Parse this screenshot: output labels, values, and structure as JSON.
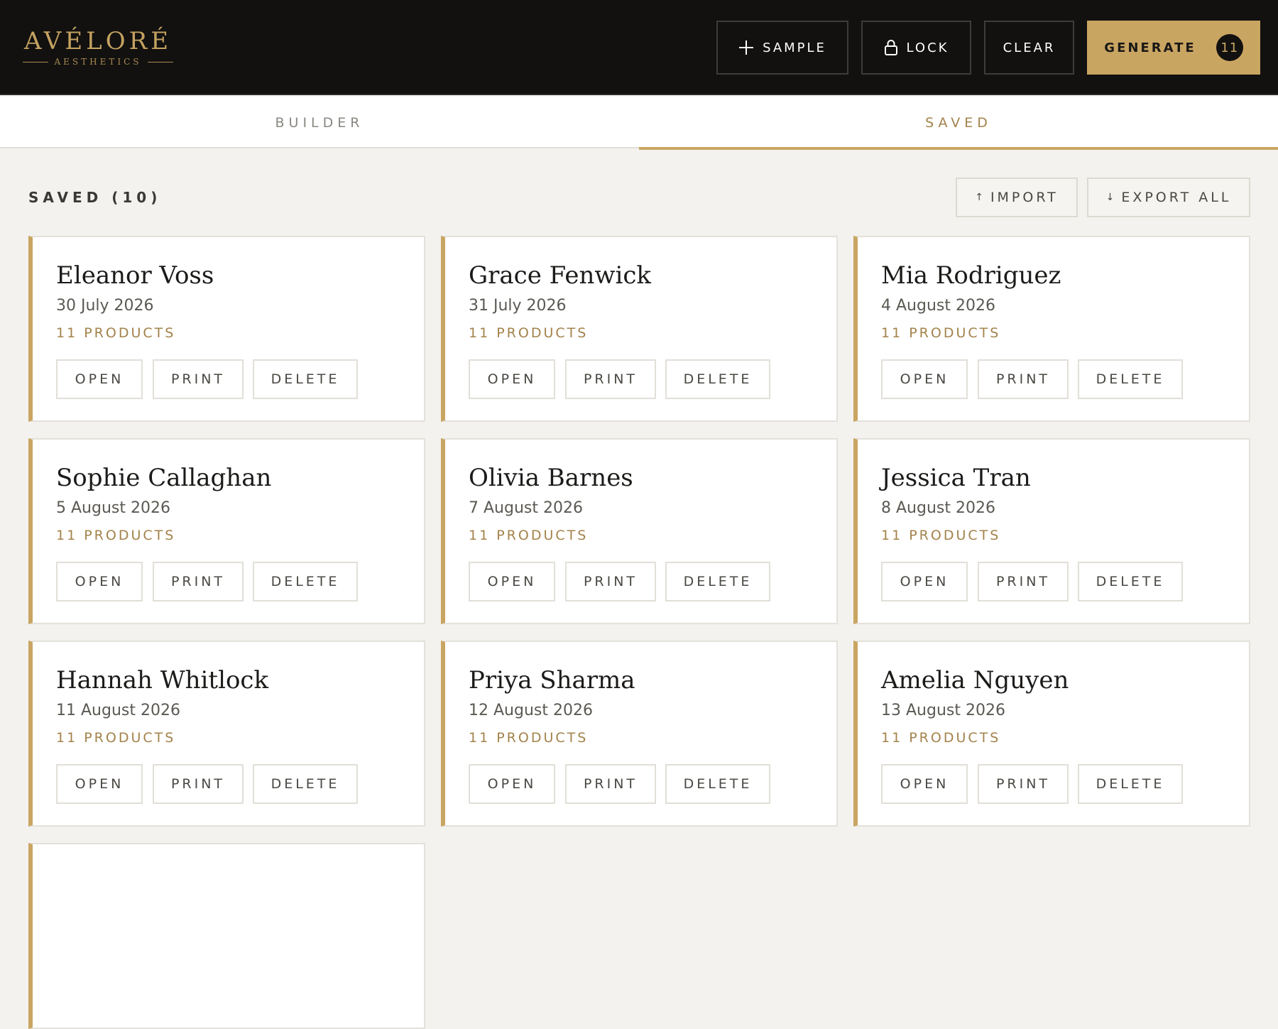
{
  "brand": {
    "name": "AVÉLORÉ",
    "tagline": "AESTHETICS"
  },
  "header_buttons": {
    "sample": "SAMPLE",
    "lock": "LOCK",
    "clear": "CLEAR",
    "generate": "GENERATE",
    "generate_count": "11"
  },
  "tabs": {
    "builder": "BUILDER",
    "saved": "SAVED",
    "active": "SAVED"
  },
  "saved": {
    "title": "SAVED (10)",
    "import": "IMPORT",
    "import_arrow": "↑",
    "export_all": "EXPORT ALL",
    "export_arrow": "↓",
    "actions": {
      "open": "OPEN",
      "print": "PRINT",
      "delete": "DELETE"
    },
    "cards": [
      {
        "name": "Eleanor Voss",
        "date": "30 July 2026",
        "products": "11 PRODUCTS"
      },
      {
        "name": "Grace Fenwick",
        "date": "31 July 2026",
        "products": "11 PRODUCTS"
      },
      {
        "name": "Mia Rodriguez",
        "date": "4 August 2026",
        "products": "11 PRODUCTS"
      },
      {
        "name": "Sophie Callaghan",
        "date": "5 August 2026",
        "products": "11 PRODUCTS"
      },
      {
        "name": "Olivia Barnes",
        "date": "7 August 2026",
        "products": "11 PRODUCTS"
      },
      {
        "name": "Jessica Tran",
        "date": "8 August 2026",
        "products": "11 PRODUCTS"
      },
      {
        "name": "Hannah Whitlock",
        "date": "11 August 2026",
        "products": "11 PRODUCTS"
      },
      {
        "name": "Priya Sharma",
        "date": "12 August 2026",
        "products": "11 PRODUCTS"
      },
      {
        "name": "Amelia Nguyen",
        "date": "13 August 2026",
        "products": "11 PRODUCTS"
      }
    ]
  },
  "colors": {
    "accent": "#c9a562",
    "header_bg": "#121110",
    "page_bg": "#f3f2ee"
  },
  "icons": {
    "sample": "plus-icon",
    "lock": "lock-icon"
  }
}
